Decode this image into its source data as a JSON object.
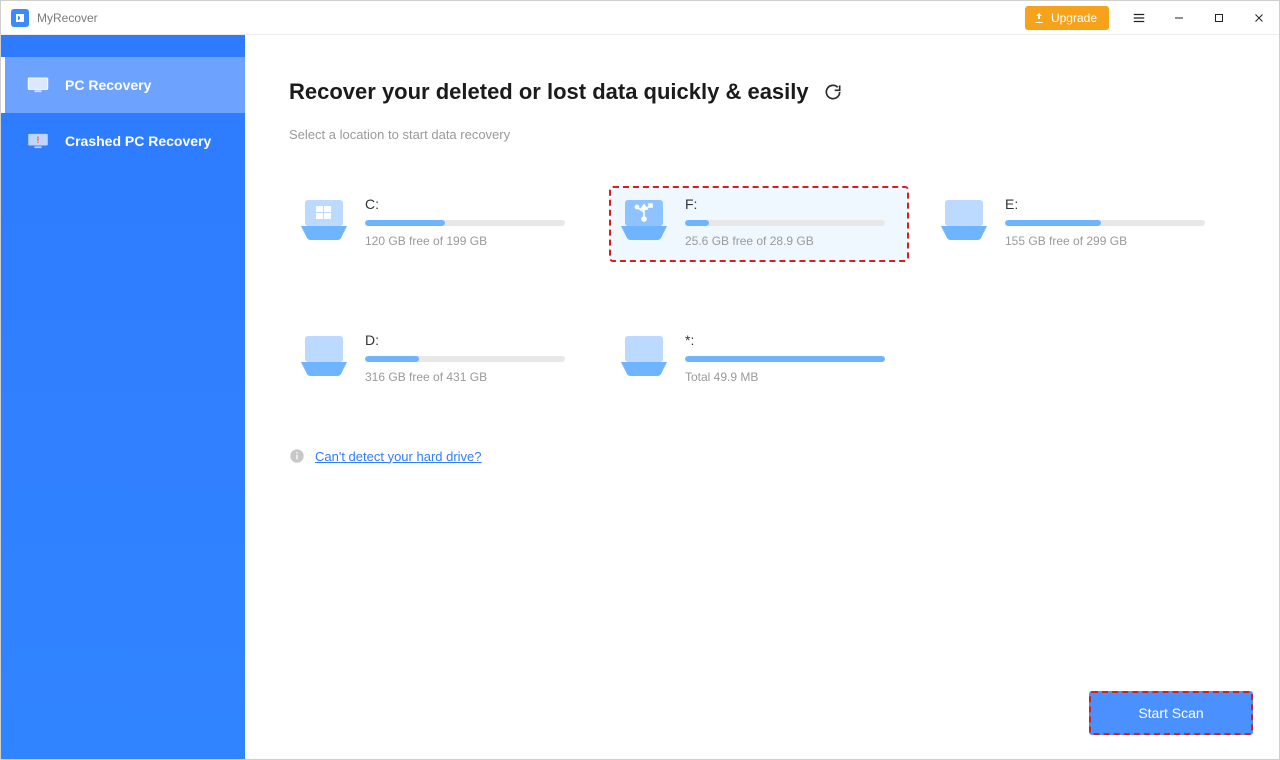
{
  "app": {
    "name": "MyRecover"
  },
  "titlebar": {
    "upgrade_label": "Upgrade"
  },
  "sidebar": {
    "items": [
      {
        "label": "PC Recovery",
        "icon": "monitor-icon",
        "active": true
      },
      {
        "label": "Crashed PC Recovery",
        "icon": "monitor-warning-icon",
        "active": false
      }
    ]
  },
  "main": {
    "heading": "Recover your deleted or lost data quickly & easily",
    "subheading": "Select a location to start data recovery",
    "help_link": "Can't detect your hard drive?",
    "start_scan_label": "Start Scan"
  },
  "drives": [
    {
      "label": "C:",
      "stats": "120 GB free of 199 GB",
      "fill_pct": 40,
      "icon": "windows",
      "selected": false
    },
    {
      "label": "F:",
      "stats": "25.6 GB free of 28.9 GB",
      "fill_pct": 12,
      "icon": "usb",
      "selected": true
    },
    {
      "label": "E:",
      "stats": "155 GB free of 299 GB",
      "fill_pct": 48,
      "icon": "drive",
      "selected": false
    },
    {
      "label": "D:",
      "stats": "316 GB free of 431 GB",
      "fill_pct": 27,
      "icon": "drive",
      "selected": false
    },
    {
      "label": "*:",
      "stats": "Total 49.9 MB",
      "fill_pct": 100,
      "icon": "drive",
      "selected": false
    }
  ]
}
